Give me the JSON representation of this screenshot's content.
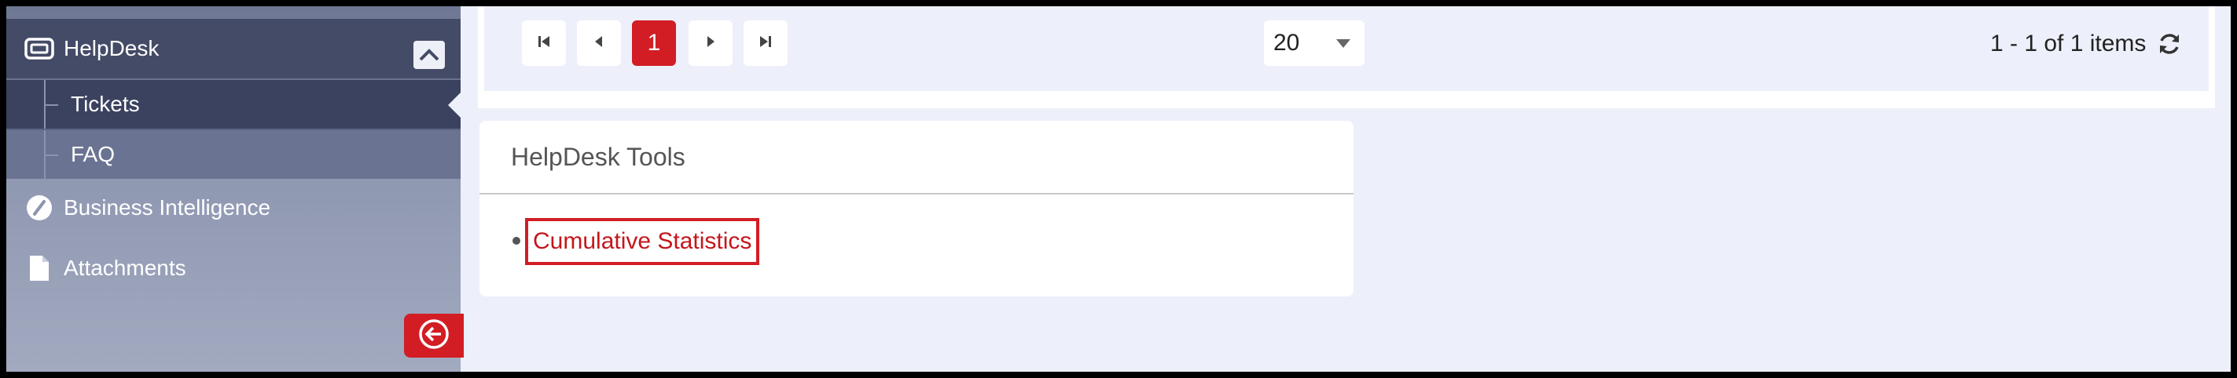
{
  "sidebar": {
    "items": [
      {
        "label": "HelpDesk",
        "icon": "ticket-icon",
        "expanded": true
      },
      {
        "label": "Tickets",
        "active": true
      },
      {
        "label": "FAQ"
      },
      {
        "label": "Business Intelligence",
        "icon": "gauge-icon"
      },
      {
        "label": "Attachments",
        "icon": "file-icon"
      }
    ],
    "collapse_icon": "chevron-up-icon",
    "back_icon": "arrow-left-circle-icon"
  },
  "pager": {
    "current_page": "1",
    "page_size": "20",
    "info": "1 - 1 of 1 items",
    "icons": [
      "first-page-icon",
      "prev-page-icon",
      "next-page-icon",
      "last-page-icon",
      "refresh-icon"
    ]
  },
  "tools": {
    "title": "HelpDesk Tools",
    "links": [
      "Cumulative Statistics"
    ]
  },
  "colors": {
    "accent": "#d21d24",
    "sidebar_active": "#3a4260",
    "background": "#edf0fa"
  }
}
